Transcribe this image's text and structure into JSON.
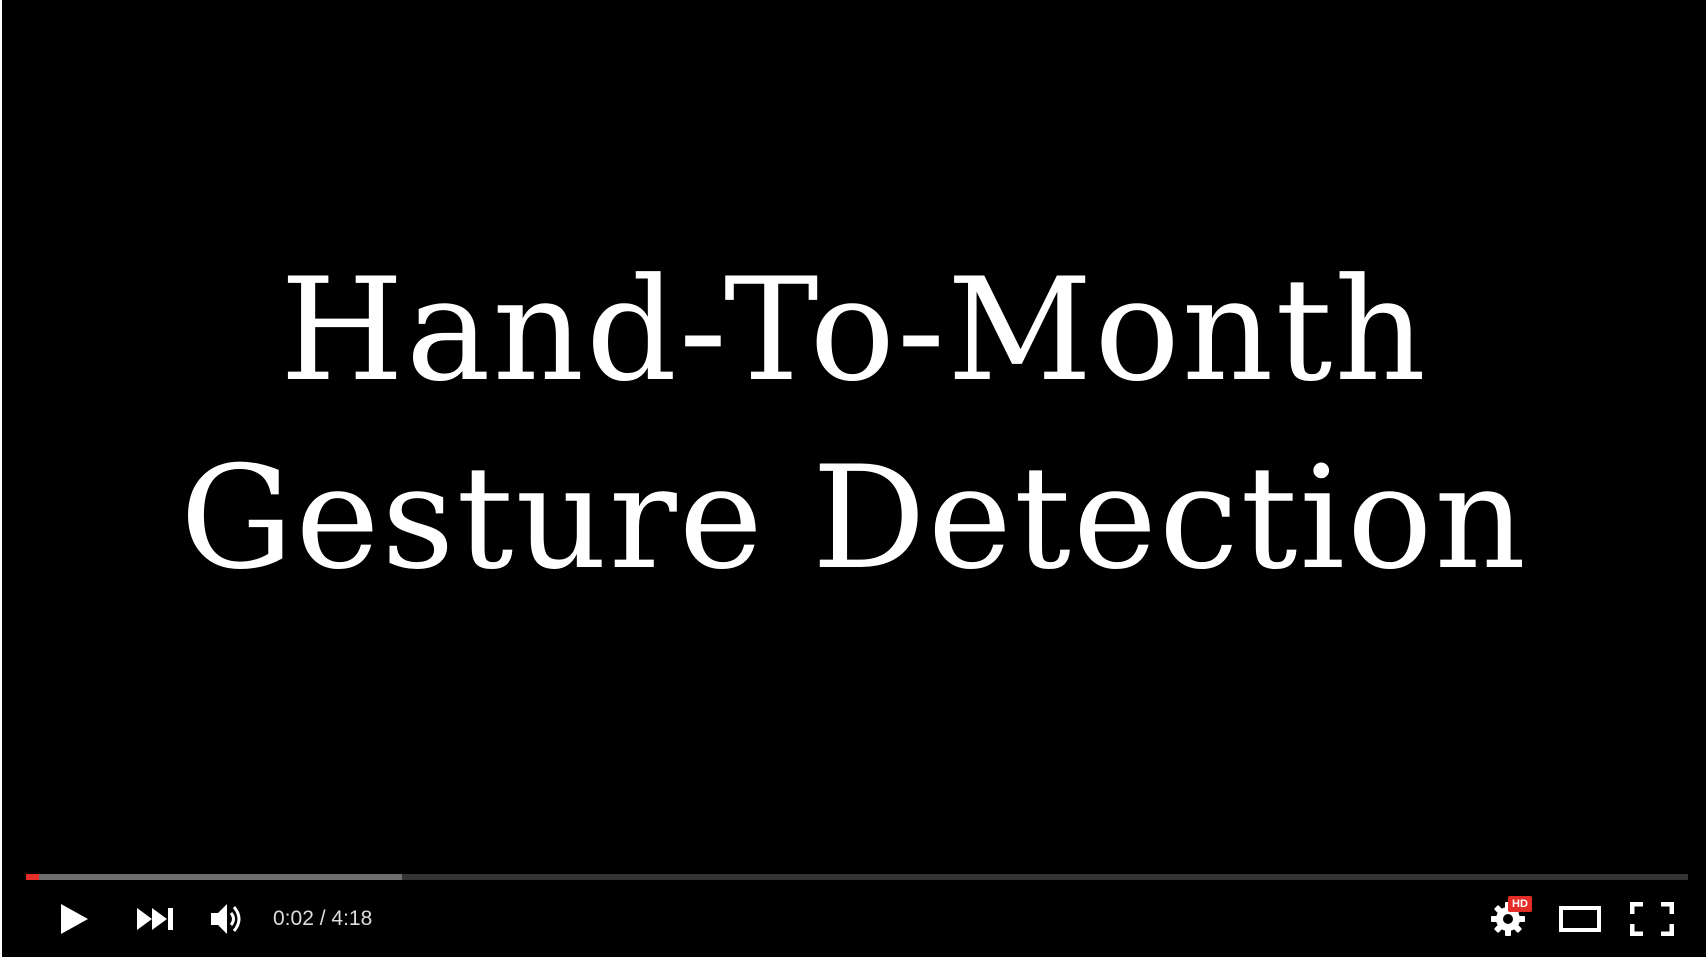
{
  "video": {
    "title_line_1": "Hand-To-Month",
    "title_line_2": "Gesture Detection"
  },
  "controls": {
    "current_time": "0:02",
    "time_separator": " / ",
    "duration": "4:18",
    "hd_badge": "HD",
    "icons": {
      "play": "play-icon",
      "next": "next-icon",
      "volume": "volume-icon",
      "settings": "gear-icon",
      "theater": "theater-mode-icon",
      "fullscreen": "fullscreen-icon"
    }
  },
  "progress": {
    "played_fraction": 0.008,
    "buffered_fraction": 0.226
  },
  "colors": {
    "accent": "#e52d27",
    "background": "#000000",
    "icon": "#ffffff"
  }
}
